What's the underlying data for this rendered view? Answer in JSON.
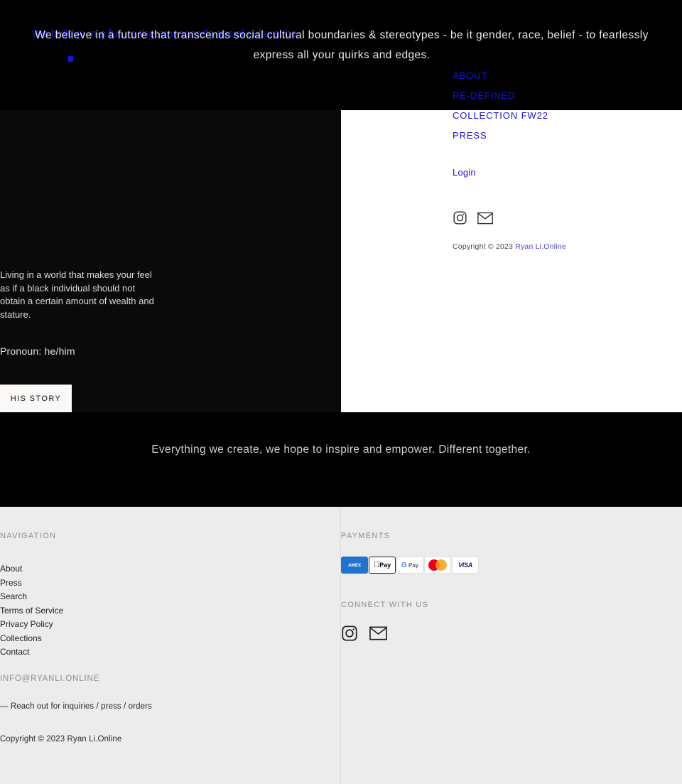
{
  "colors": {
    "link_blue": "#1b12e0",
    "dark_bg": "#000000",
    "panel_white": "#ffffff",
    "footer_bg": "#ececec",
    "button_bg": "#fbf9f7"
  },
  "hero": {
    "message": "We believe in a future that transcends social cultural boundaries & stereotypes - be it gender, race, belief - to fearlessly express all your quirks and edges.",
    "ghost_message": "We believe in a future that transcends social cultural bo"
  },
  "menu": {
    "items": [
      {
        "label": "ABOUT"
      },
      {
        "label": "RE-DEFINED"
      },
      {
        "label": "COLLECTION FW22"
      },
      {
        "label": "PRESS"
      }
    ],
    "login_label": "Login",
    "copyright_prefix": "Copyright © 2023 ",
    "copyright_brand": "Ryan Li.Online",
    "social": [
      {
        "name": "instagram-icon"
      },
      {
        "name": "email-icon"
      }
    ]
  },
  "profile": {
    "bio": "Living in a world that makes your feel as if a black individual should not obtain a certain amount of wealth and stature.",
    "pronoun": "Pronoun: he/him",
    "story_button": "HIS STORY"
  },
  "quote": {
    "text": "Everything we create, we hope to inspire and empower. Different together."
  },
  "footer": {
    "navigation_heading": "NAVIGATION",
    "navigation_links": [
      {
        "label": "About"
      },
      {
        "label": "Press"
      },
      {
        "label": "Search"
      },
      {
        "label": "Terms of Service"
      },
      {
        "label": "Privacy Policy"
      },
      {
        "label": "Collections"
      },
      {
        "label": "Contact"
      }
    ],
    "email": "INFO@RYANLI.ONLINE",
    "reach_out": "— Reach out for inquiries / press / orders",
    "copyright": "Copyright © 2023 Ryan Li.Online",
    "payments_heading": "PAYMENTS",
    "payment_methods": [
      {
        "name": "amex-card-icon",
        "label": "AMEX"
      },
      {
        "name": "apple-pay-card-icon",
        "label": "Pay"
      },
      {
        "name": "google-pay-card-icon",
        "label": "Pay"
      },
      {
        "name": "mastercard-card-icon",
        "label": ""
      },
      {
        "name": "visa-card-icon",
        "label": "VISA"
      }
    ],
    "connect_heading": "CONNECT WITH US",
    "connect_social": [
      {
        "name": "instagram-icon"
      },
      {
        "name": "email-icon"
      }
    ]
  }
}
